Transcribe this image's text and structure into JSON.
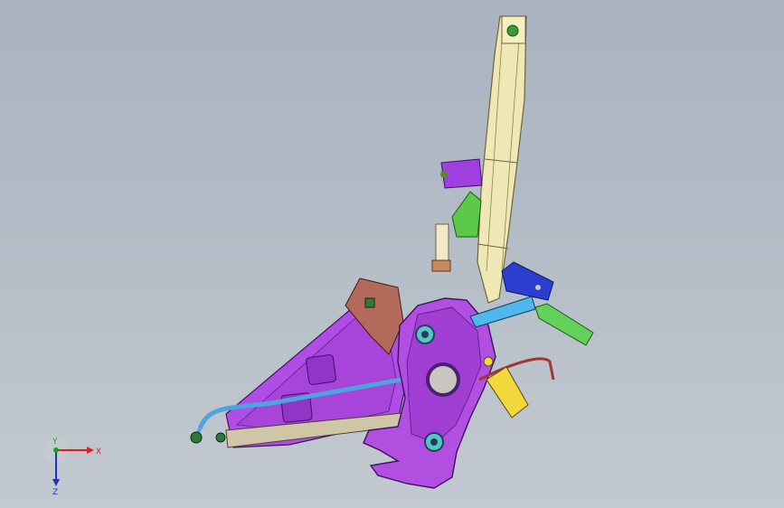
{
  "viewport": {
    "background_top": "#a9b3bf",
    "background_bottom": "#c3c9d0"
  },
  "model": {
    "colors": {
      "rail": "#f0e8b4",
      "rail_edge": "#6b6540",
      "bracket_main": "#b14fe0",
      "bracket_main_dark": "#8a2fc0",
      "triangle_plate": "#b04de6",
      "cable": "#4aa6dc",
      "blue_bracket": "#2a3fd0",
      "green_part": "#5cc94a",
      "brown_block": "#b46a5a",
      "yellow_lever": "#f2d83a",
      "teal_fastener": "#2aa39a",
      "orange_part": "#e7a37a"
    }
  },
  "triad": {
    "x_label": "X",
    "y_label": "Y",
    "z_label": "Z",
    "x_color": "#e02020",
    "y_color": "#1aa01a",
    "z_color": "#2030c0"
  }
}
